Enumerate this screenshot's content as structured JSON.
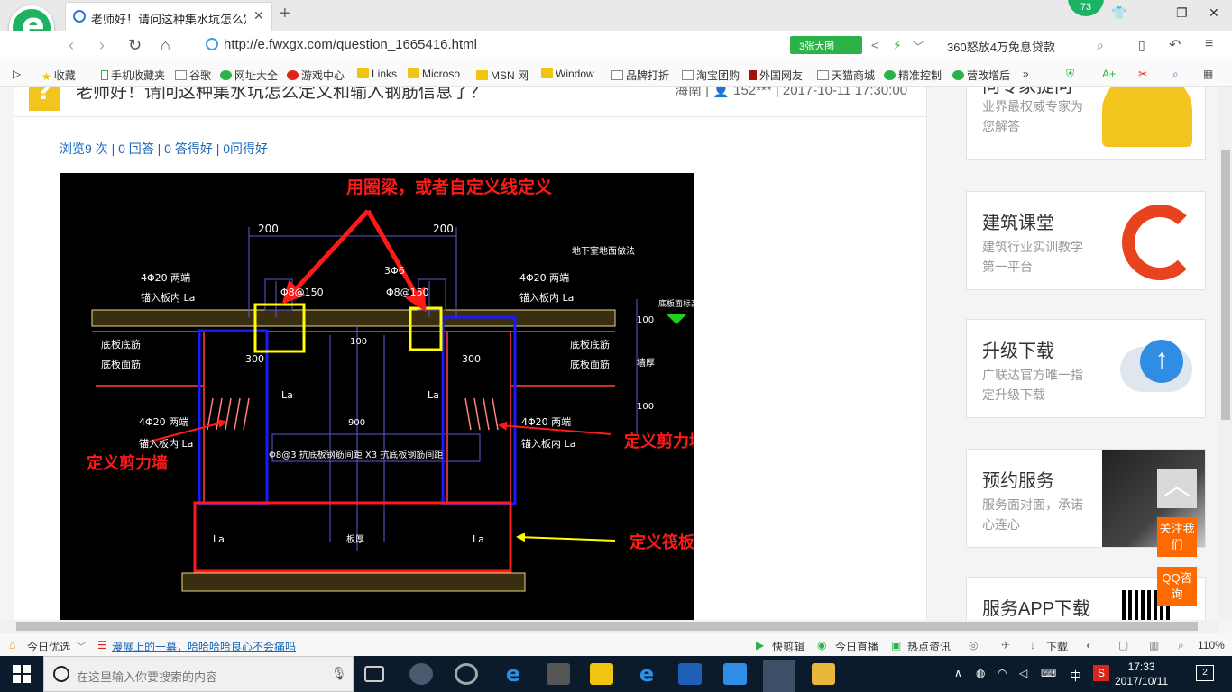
{
  "browser": {
    "tab_title": "老师好！请问这种集水坑怎么定义...",
    "badge": "73",
    "url": "http://e.fwxgx.com/question_1665416.html",
    "screenshot_label": "3张大图",
    "ad_text": "360怒放4万免息贷款"
  },
  "bookmarks": [
    "收藏",
    "手机收藏夹",
    "谷歌",
    "网址大全",
    "游戏中心",
    "Links",
    "Microso",
    "MSN 网",
    "Window",
    "品牌打折",
    "淘宝团购",
    "外国网友",
    "天猫商城",
    "精准控制",
    "营改增后"
  ],
  "question": {
    "title": "老师好！请问这种集水坑怎么定义和输入钢筋信息了？",
    "region": "海南",
    "user": "152***",
    "datetime": "2017-10-11 17:30:00",
    "stats": "浏览9 次 | 0 回答 | 0 答得好 | 0问得好"
  },
  "drawing": {
    "annot_top": "用圈梁，或者自定义线定义",
    "annot_left": "定义剪力墙",
    "annot_right": "定义剪力墙",
    "annot_bottom": "定义筏板",
    "dim_200": "200",
    "rebar_4020_a": "4Φ20  两端",
    "rebar_anchor": "锚入板内  La",
    "rebar_3phi": "3Φ6",
    "rebar_8150": "Φ8@150",
    "slab_bottom": "底板底筋",
    "slab_top": "底板面筋",
    "basement": "地下室地面做法",
    "wall_label": "墙厚",
    "mid_text": "Φ8@3 抗底板钢筋间距    X3 抗底板钢筋间距",
    "floor_label": "底板面标高",
    "dim_300": "300",
    "dim_100": "100",
    "dim_900": "900",
    "la": "La",
    "raft_mid": "板厚"
  },
  "sidebar": [
    {
      "title": "向专家提问",
      "sub": "业界最权威专家为您解答"
    },
    {
      "title": "建筑课堂",
      "sub": "建筑行业实训教学第一平台"
    },
    {
      "title": "升级下载",
      "sub": "广联达官方唯一指定升级下载"
    },
    {
      "title": "预约服务",
      "sub": "服务面对面，承诺心连心"
    },
    {
      "title": "服务APP下载",
      "sub": ""
    }
  ],
  "float": {
    "up": "︿",
    "follow": "关注我们",
    "qq": "QQ咨询"
  },
  "statusbar": {
    "news": "今日优选",
    "headline": "漫展上的一幕，哈哈哈哈良心不会痛吗",
    "quickcut": "快剪辑",
    "live": "今日直播",
    "hotnews": "热点资讯",
    "download": "下载",
    "zoom": "110%"
  },
  "taskbar": {
    "search_placeholder": "在这里输入你要搜索的内容",
    "ime": "中",
    "time": "17:33",
    "date": "2017/10/11",
    "notify_count": "2"
  }
}
